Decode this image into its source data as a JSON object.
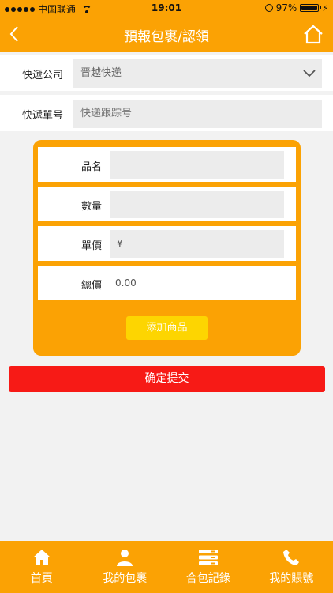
{
  "status_bar": {
    "carrier": "中国联通",
    "time": "19:01",
    "battery": "97%",
    "battery_level": 0.97
  },
  "header": {
    "title": "預報包裹/認領"
  },
  "form": {
    "courier_label": "快遞公司",
    "courier_value": "晋越快递",
    "tracking_label": "快遞單号",
    "tracking_placeholder": "快递跟踪号"
  },
  "goods": {
    "name_label": "品名",
    "quantity_label": "數量",
    "unit_price_label": "單價",
    "unit_price_prefix": "¥",
    "total_label": "總價",
    "total_value": "0.00",
    "add_button": "添加商品"
  },
  "submit_button": "确定提交",
  "tabs": [
    {
      "label": "首頁",
      "icon": "home-icon"
    },
    {
      "label": "我的包裹",
      "icon": "user-icon"
    },
    {
      "label": "合包記錄",
      "icon": "server-list-icon"
    },
    {
      "label": "我的賬號",
      "icon": "phone-icon"
    }
  ],
  "colors": {
    "accent": "#fba204",
    "add_button": "#fdd501",
    "submit": "#f71a16"
  }
}
